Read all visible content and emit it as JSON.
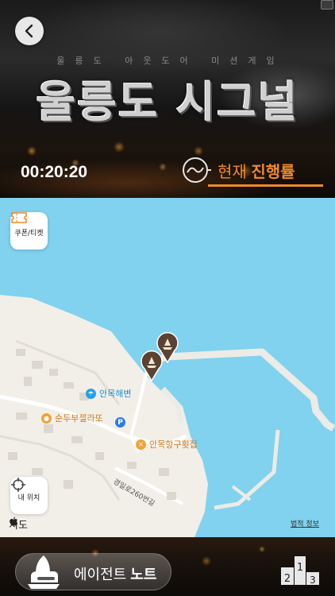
{
  "header": {
    "subtitle": "울릉도 아웃도어 미션게임",
    "title": "울릉도 시그널",
    "timer": "00:20:20",
    "progress_prefix": "현재",
    "progress_label": "진행률"
  },
  "map": {
    "coupon_label": "쿠폰/티켓",
    "location_label": "내 위치",
    "attribution": "지도",
    "legal_link": "법적 정보",
    "road_name": "경일로260번길",
    "pois": [
      {
        "name": "안목해변",
        "icon": "beach-umbrella-icon",
        "color": "#1fa3e8"
      },
      {
        "name": "순두부젤라또",
        "icon": "lightbulb-icon",
        "color": "#f2a23a"
      },
      {
        "name": "안목항구횟집",
        "icon": "fork-knife-icon",
        "color": "#f2a23a"
      }
    ],
    "parking": "P"
  },
  "footer": {
    "agent_prefix": "에이전트",
    "agent_label": "노트"
  },
  "colors": {
    "accent": "#f08a2a",
    "water": "#80d2ee",
    "land": "#f2efe9",
    "pin": "#5b4231"
  }
}
